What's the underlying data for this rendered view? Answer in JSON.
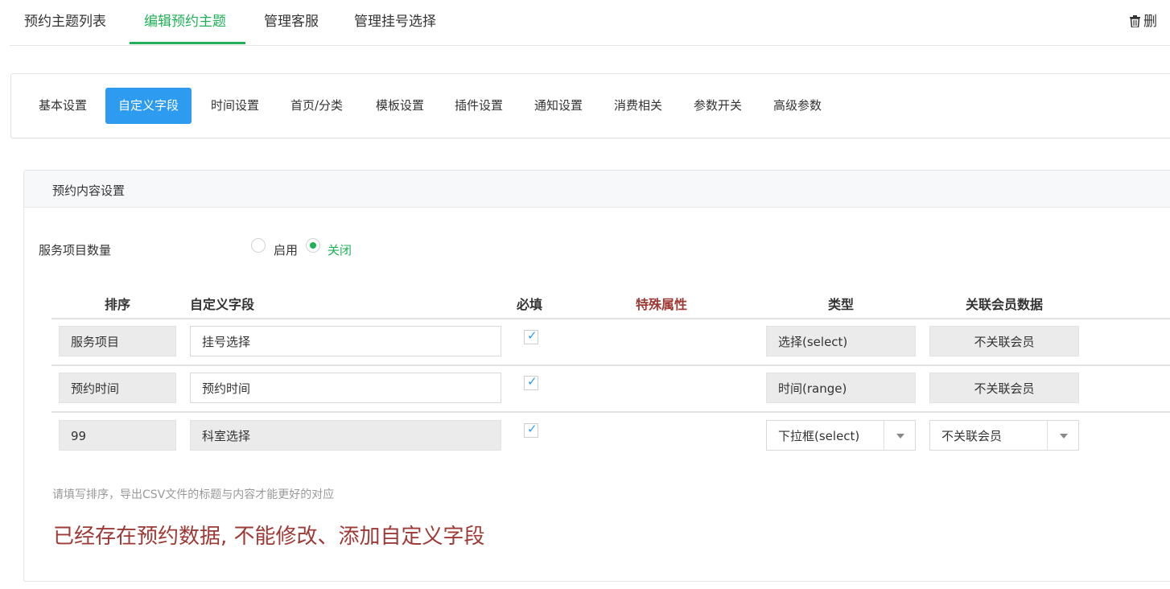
{
  "top_tabs": [
    "预约主题列表",
    "编辑预约主题",
    "管理客服",
    "管理挂号选择"
  ],
  "delete_label": "删",
  "sub_tabs": [
    "基本设置",
    "自定义字段",
    "时间设置",
    "首页/分类",
    "模板设置",
    "插件设置",
    "通知设置",
    "消费相关",
    "参数开关",
    "高级参数"
  ],
  "panel": {
    "title": "预约内容设置",
    "service_count_label": "服务项目数量",
    "radio_enable": "启用",
    "radio_disable": "关闭",
    "selected": "关闭"
  },
  "table": {
    "headers": [
      "排序",
      "自定义字段",
      "必填",
      "特殊属性",
      "类型",
      "关联会员数据"
    ],
    "rows": [
      {
        "sort": "服务项目",
        "field": "挂号选择",
        "required": true,
        "type": "选择(select)",
        "member": "不关联会员"
      },
      {
        "sort": "预约时间",
        "field": "预约时间",
        "required": true,
        "type": "时间(range)",
        "member": "不关联会员"
      },
      {
        "sort": "99",
        "field": "科室选择",
        "required": true,
        "type": "下拉框(select)",
        "member": "不关联会员"
      }
    ]
  },
  "hint": "请填写排序，导出CSV文件的标题与内容才能更好的对应",
  "warning": "已经存在预约数据, 不能修改、添加自定义字段",
  "colors": {
    "accent_green": "#1fb155",
    "accent_blue": "#2d9bf0",
    "warning_red": "#9e3a36"
  }
}
